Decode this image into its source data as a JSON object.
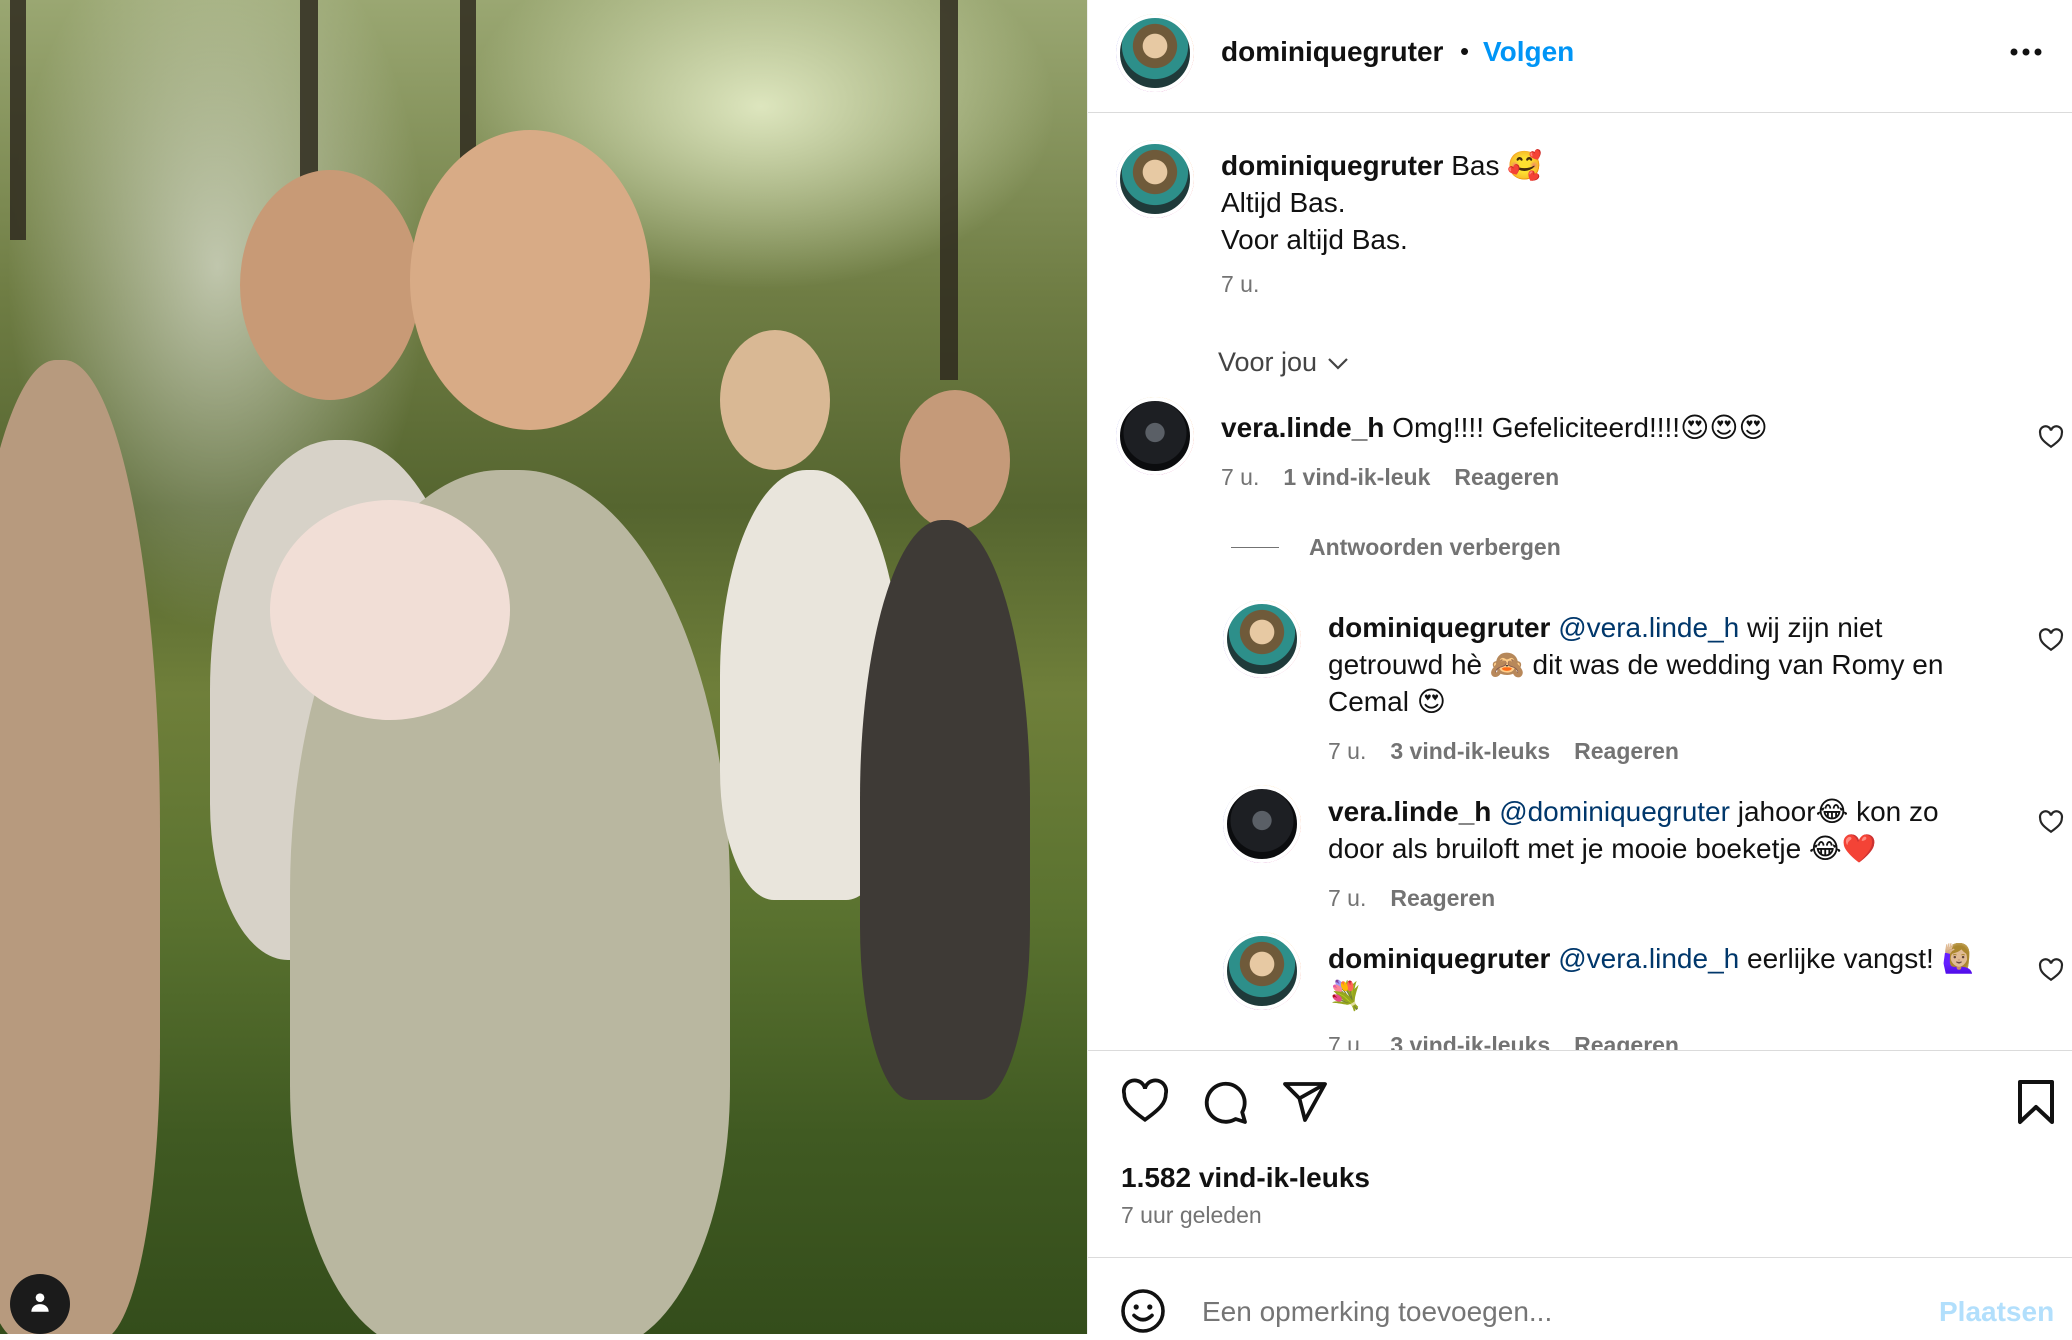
{
  "post_author": {
    "username": "dominiquegruter",
    "separator": "•",
    "follow_label": "Volgen"
  },
  "caption": {
    "username": "dominiquegruter",
    "line1": "Bas 🥰",
    "line2": "Altijd Bas.",
    "line3": "Voor altijd Bas.",
    "time": "7 u."
  },
  "for_you": {
    "label": "Voor jou"
  },
  "comments": [
    {
      "username": "vera.linde_h",
      "text": "Omg!!!! Gefeliciteerd!!!!😍😍😍",
      "time": "7 u.",
      "likes": "1 vind-ik-leuk",
      "reply_label": "Reageren",
      "hide_replies_label": "Antwoorden verbergen",
      "replies": [
        {
          "username": "dominiquegruter",
          "mention": "@vera.linde_h",
          "text_line1": " wij zijn niet",
          "text_line2": "getrouwd hè 🙈 dit was de wedding van Romy en",
          "text_line3": "Cemal 😍",
          "time": "7 u.",
          "likes": "3 vind-ik-leuks",
          "reply_label": "Reageren"
        },
        {
          "username": "vera.linde_h",
          "mention": "@dominiquegruter",
          "text_line1": " jahoor😂 kon zo",
          "text_line2": "door als bruiloft met je mooie boeketje 😂❤️",
          "time": "7 u.",
          "reply_label": "Reageren"
        },
        {
          "username": "dominiquegruter",
          "mention": "@vera.linde_h",
          "text_line1": " eerlijke vangst! 🙋🏼‍♀️",
          "text_line2": "💐",
          "time": "7 u.",
          "likes": "3 vind-ik-leuks",
          "reply_label": "Reageren"
        }
      ]
    }
  ],
  "actions": {
    "likes_count": "1.582 vind-ik-leuks",
    "posted_ago": "7 uur geleden"
  },
  "comment_box": {
    "placeholder": "Een opmerking toevoegen...",
    "submit_label": "Plaatsen"
  },
  "icons": {
    "more": "more-options-icon",
    "like": "heart-icon",
    "comment": "comment-icon",
    "share": "share-icon",
    "save": "bookmark-icon",
    "emoji": "emoji-icon",
    "user_tag": "person-icon"
  },
  "colors": {
    "accent": "#0095f6",
    "mention": "#00376b",
    "muted": "#737373",
    "divider": "#dbdbdb",
    "placeholder_button": "#b2dffc"
  }
}
